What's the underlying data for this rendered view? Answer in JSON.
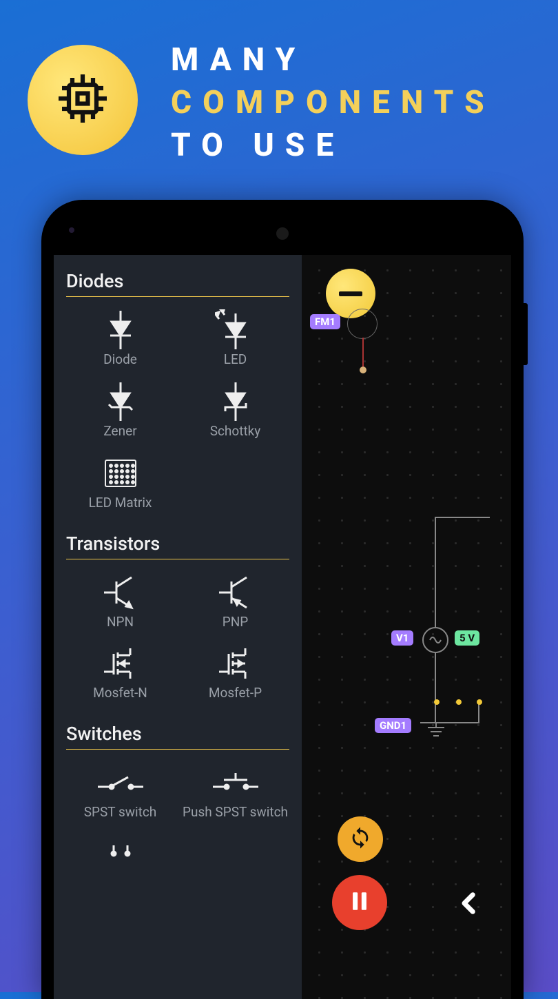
{
  "headline": {
    "line1": "MANY",
    "line2": "COMPONENTS",
    "line3": "TO USE"
  },
  "panel": {
    "sections": {
      "diodes": {
        "title": "Diodes",
        "items": [
          "Diode",
          "LED",
          "Zener",
          "Schottky",
          "LED Matrix"
        ]
      },
      "transistors": {
        "title": "Transistors",
        "items": [
          "NPN",
          "PNP",
          "Mosfet-N",
          "Mosfet-P"
        ]
      },
      "switches": {
        "title": "Switches",
        "items": [
          "SPST switch",
          "Push SPST switch"
        ]
      }
    }
  },
  "canvas": {
    "tags": {
      "fm1": "FM1",
      "v1": "V1",
      "fiveV": "5 V",
      "gnd1": "GND1"
    }
  },
  "colors": {
    "accentYellow": "#f2c938",
    "accentPurple": "#a47cff",
    "accentGreen": "#6de6a0",
    "accentOrange": "#f0a92c",
    "accentRed": "#e8402d",
    "panelBg": "#20252d"
  }
}
